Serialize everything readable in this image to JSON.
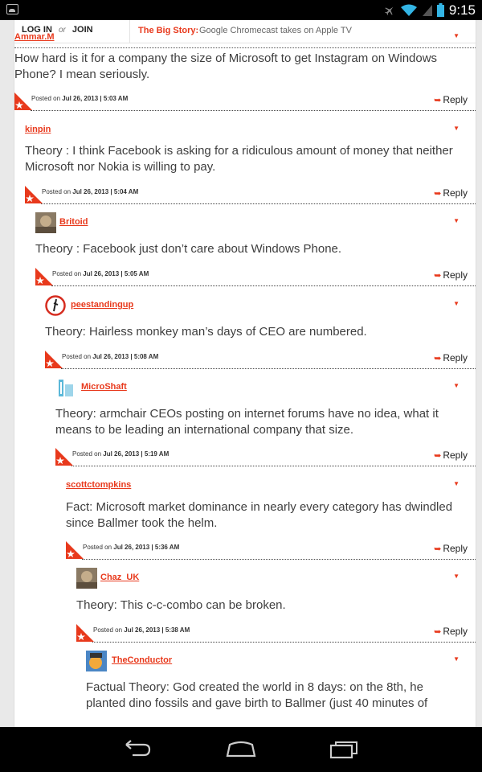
{
  "status_bar": {
    "time": "9:15"
  },
  "top_bar": {
    "login": "LOG IN",
    "or": "or",
    "join": "JOIN",
    "big_story_label": "The Big Story:",
    "big_story_headline": "Google Chromecast takes on Apple TV"
  },
  "comments": [
    {
      "author": "Ammar.M",
      "text": "How hard is it for a company the size of Microsoft to get Instagram on Windows Phone? I mean seriously.",
      "posted_prefix": "Posted on",
      "posted": "Jul 26, 2013 | 5:03 AM",
      "reply": "Reply",
      "avatar": "none"
    },
    {
      "author": "kinpin",
      "text": "Theory : I think Facebook is asking for a ridiculous amount of money that neither Microsoft nor Nokia is willing to pay.",
      "posted_prefix": "Posted on",
      "posted": "Jul 26, 2013 | 5:04 AM",
      "reply": "Reply",
      "avatar": "none"
    },
    {
      "author": "Britoid",
      "text": "Theory : Facebook just don’t care about Windows Phone.",
      "posted_prefix": "Posted on",
      "posted": "Jul 26, 2013 | 5:05 AM",
      "reply": "Reply",
      "avatar": "photo-avatar"
    },
    {
      "author": "peestandingup",
      "text": "Theory: Hairless monkey man’s days of CEO are numbered.",
      "posted_prefix": "Posted on",
      "posted": "Jul 26, 2013 | 5:08 AM",
      "reply": "Reply",
      "avatar": "circle-logo-avatar"
    },
    {
      "author": "MicroShaft",
      "text": "Theory: armchair CEOs posting on internet forums have no idea, what it means to be leading an international company that size.",
      "posted_prefix": "Posted on",
      "posted": "Jul 26, 2013 | 5:19 AM",
      "reply": "Reply",
      "avatar": "blue-logo-avatar"
    },
    {
      "author": "scottctompkins",
      "text": "Fact: Microsoft market dominance in nearly every category has dwindled since Ballmer took the helm.",
      "posted_prefix": "Posted on",
      "posted": "Jul 26, 2013 | 5:36 AM",
      "reply": "Reply",
      "avatar": "none"
    },
    {
      "author": "Chaz_UK",
      "text": "Theory: This c-c-combo can be broken.",
      "posted_prefix": "Posted on",
      "posted": "Jul 26, 2013 | 5:38 AM",
      "reply": "Reply",
      "avatar": "photo-avatar"
    },
    {
      "author": "TheConductor",
      "text": "Factual Theory: God created the world in 8 days: on the 8th, he planted dino fossils and gave birth to Ballmer (just 40 minutes of",
      "posted_prefix": "",
      "posted": "",
      "reply": "",
      "avatar": "cartoon-avatar"
    }
  ],
  "colors": {
    "accent": "#e8391c",
    "text": "#3e3e3e"
  }
}
